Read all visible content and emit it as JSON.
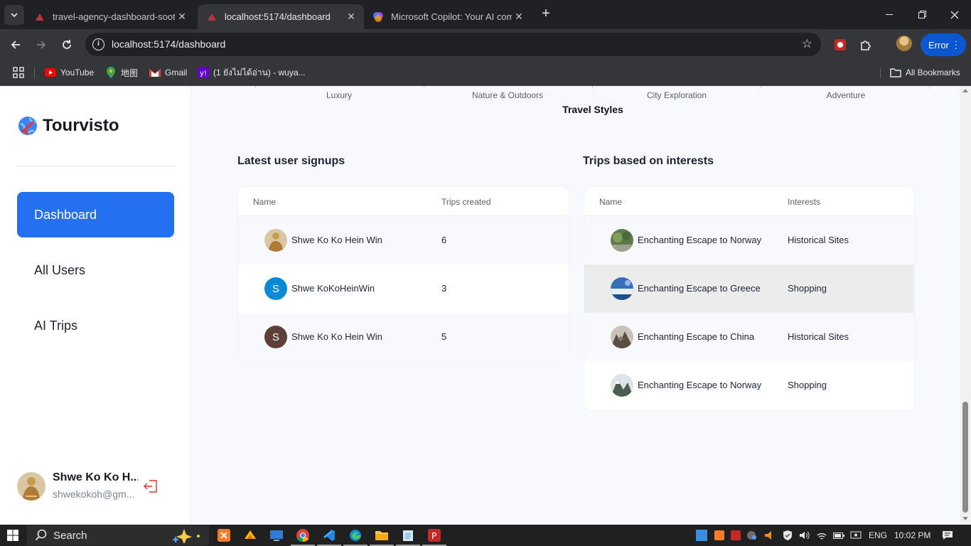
{
  "browser": {
    "tabs": [
      {
        "title": "travel-agency-dashboard-sooty",
        "active": false
      },
      {
        "title": "localhost:5174/dashboard",
        "active": true
      },
      {
        "title": "Microsoft Copilot: Your AI comp",
        "active": false
      }
    ],
    "url": "localhost:5174/dashboard",
    "profile_status": "Error",
    "bookmarks": [
      {
        "label": "YouTube",
        "icon": "youtube-icon"
      },
      {
        "label": "地图",
        "icon": "maps-icon"
      },
      {
        "label": "Gmail",
        "icon": "gmail-icon"
      },
      {
        "label": "(1 ยังไม่ได้อ่าน) - wuya...",
        "icon": "yahoo-icon"
      }
    ],
    "all_bookmarks": "All Bookmarks"
  },
  "app": {
    "brand": "Tourvisto",
    "nav": [
      {
        "label": "Dashboard",
        "active": true
      },
      {
        "label": "All Users",
        "active": false
      },
      {
        "label": "AI Trips",
        "active": false
      }
    ],
    "user": {
      "name": "Shwe Ko Ko H...",
      "email": "shwekokoh@gm..."
    }
  },
  "chart_data": {
    "type": "bar",
    "title": "Travel Styles",
    "categories": [
      "Luxury",
      "Nature & Outdoors",
      "City Exploration",
      "Adventure"
    ]
  },
  "signups": {
    "title": "Latest user signups",
    "columns": [
      "Name",
      "Trips created"
    ],
    "rows": [
      {
        "name": "Shwe Ko Ko Hein Win",
        "value": "6",
        "avatar": "photo"
      },
      {
        "name": "Shwe KoKoHeinWin",
        "value": "3",
        "avatar_letter": "S",
        "avatar_color": "#0a8ad6"
      },
      {
        "name": "Shwe Ko Ko Hein Win",
        "value": "5",
        "avatar_letter": "S",
        "avatar_color": "#5d4037"
      }
    ]
  },
  "interests": {
    "title": "Trips based on interests",
    "columns": [
      "Name",
      "Interests"
    ],
    "rows": [
      {
        "name": "Enchanting Escape to Norway",
        "value": "Historical Sites"
      },
      {
        "name": "Enchanting Escape to Greece",
        "value": "Shopping"
      },
      {
        "name": "Enchanting Escape to China",
        "value": "Historical Sites"
      },
      {
        "name": "Enchanting Escape to Norway",
        "value": "Shopping"
      }
    ]
  },
  "taskbar": {
    "search_placeholder": "Search",
    "language": "ENG",
    "time": "10:02 PM"
  },
  "colors": {
    "accent": "#256ff1",
    "logout": "#e0352b"
  }
}
